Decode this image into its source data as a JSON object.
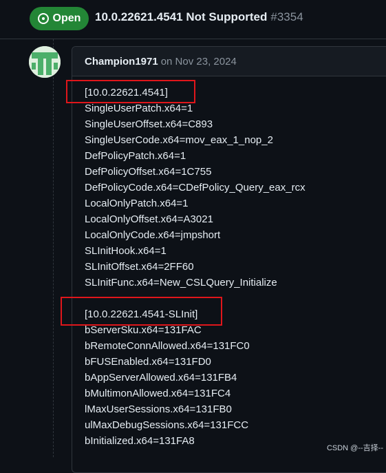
{
  "issue": {
    "status": "Open",
    "title": "10.0.22621.4541 Not Supported",
    "number": "#3354"
  },
  "comment": {
    "author": "Champion1971",
    "date": "on Nov 23, 2024",
    "section1": [
      "[10.0.22621.4541]",
      "SingleUserPatch.x64=1",
      "SingleUserOffset.x64=C893",
      "SingleUserCode.x64=mov_eax_1_nop_2",
      "DefPolicyPatch.x64=1",
      "DefPolicyOffset.x64=1C755",
      "DefPolicyCode.x64=CDefPolicy_Query_eax_rcx",
      "LocalOnlyPatch.x64=1",
      "LocalOnlyOffset.x64=A3021",
      "LocalOnlyCode.x64=jmpshort",
      "SLInitHook.x64=1",
      "SLInitOffset.x64=2FF60",
      "SLInitFunc.x64=New_CSLQuery_Initialize"
    ],
    "section2": [
      "[10.0.22621.4541-SLInit]",
      "bServerSku.x64=131FAC",
      "bRemoteConnAllowed.x64=131FC0",
      "bFUSEnabled.x64=131FD0",
      "bAppServerAllowed.x64=131FB4",
      "bMultimonAllowed.x64=131FC4",
      "lMaxUserSessions.x64=131FB0",
      "ulMaxDebugSessions.x64=131FCC",
      "bInitialized.x64=131FA8"
    ]
  },
  "watermark": "CSDN @--吉择--",
  "colors": {
    "background": "#0d1117",
    "open_badge": "#238636",
    "highlight_box": "#e0161b",
    "muted_text": "#8b949e"
  }
}
